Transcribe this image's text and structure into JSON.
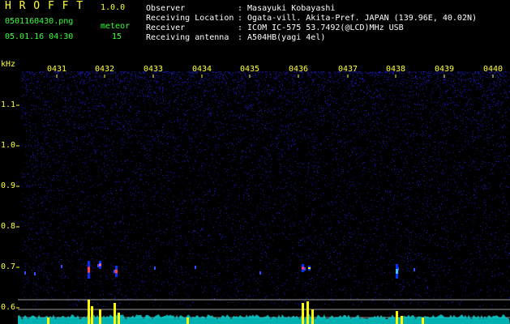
{
  "header": {
    "app_name": "H R O F F T",
    "version": "1.0.0",
    "filename": "0501160430.png",
    "datetime": "05.01.16 04:30",
    "meteor_label": "meteor",
    "meteor_count": "15",
    "info": [
      {
        "label": "Observer",
        "value": ": Masayuki Kobayashi"
      },
      {
        "label": "Receiving Location",
        "value": ": Ogata-vill. Akita-Pref. JAPAN (139.96E, 40.02N)"
      },
      {
        "label": "Receiver",
        "value": ": ICOM IC-575 53.7492(@LCD)MHz USB"
      },
      {
        "label": "Receiving antenna",
        "value": ": A504HB(yagi 4el)"
      }
    ]
  },
  "spectrogram": {
    "unit": "kHz",
    "time_labels": [
      "0431",
      "0432",
      "0433",
      "0434",
      "0435",
      "0436",
      "0437",
      "0438",
      "0439",
      "0440"
    ],
    "freq_labels": [
      "1.1",
      "1.0",
      "0.9",
      "0.8",
      "0.7",
      "0.6"
    ],
    "colors": {
      "text_green": "#33ff33",
      "text_yellow": "#ffff33",
      "noise": "#1a1aa0",
      "peak": "#ffff00",
      "baseline": "#00e0e0"
    }
  }
}
